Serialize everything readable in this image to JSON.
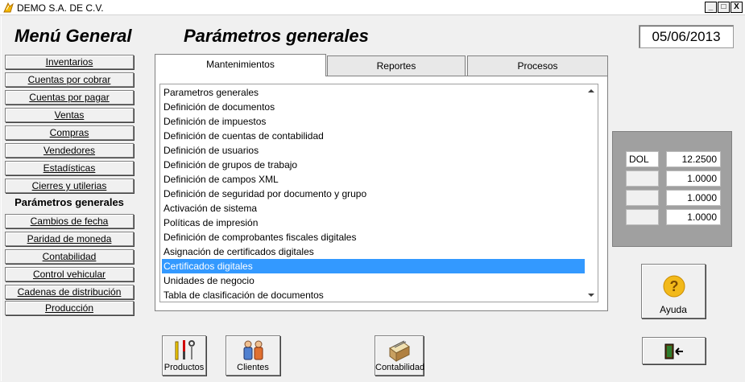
{
  "window": {
    "title": "DEMO  S.A. DE C.V.",
    "minimize": "_",
    "maximize": "□",
    "close": "X"
  },
  "headings": {
    "menu": "Menú General",
    "params": "Parámetros generales"
  },
  "date": "05/06/2013",
  "sidebar": {
    "items": [
      {
        "label": "Inventarios"
      },
      {
        "label": "Cuentas por cobrar"
      },
      {
        "label": "Cuentas por pagar"
      },
      {
        "label": "Ventas"
      },
      {
        "label": "Compras"
      },
      {
        "label": "Vendedores"
      },
      {
        "label": "Estadísticas"
      },
      {
        "label": "Cierres y utilerias"
      },
      {
        "label": "Parámetros generales",
        "active": true
      },
      {
        "label": "Cambios de fecha"
      },
      {
        "label": "Paridad de moneda"
      },
      {
        "label": "Contabilidad"
      },
      {
        "label": "Control vehicular"
      },
      {
        "label": "Cadenas de distribución"
      },
      {
        "label": "Producción"
      }
    ]
  },
  "tabs": [
    {
      "label": "Mantenimientos",
      "active": true
    },
    {
      "label": "Reportes"
    },
    {
      "label": "Procesos"
    }
  ],
  "list": {
    "items": [
      "Parametros generales",
      "Definición de documentos",
      "Definición de impuestos",
      "Definición de cuentas de contabilidad",
      "Definición de usuarios",
      "Definición de grupos de trabajo",
      "Definición de campos XML",
      "Definición de seguridad por documento y grupo",
      "Activación  de sistema",
      "Políticas de  impresión",
      "Definición de comprobantes fiscales digitales",
      "Asignación de certificados digitales",
      "Certificados digitales",
      "Unidades de negocio",
      "Tabla de clasificación de documentos"
    ],
    "selected": "Certificados digitales"
  },
  "rates": [
    {
      "currency": "DOL",
      "value": "12.2500"
    },
    {
      "currency": "",
      "value": "1.0000"
    },
    {
      "currency": "",
      "value": "1.0000"
    },
    {
      "currency": "",
      "value": "1.0000"
    }
  ],
  "buttons": {
    "help": "Ayuda",
    "products": "Productos",
    "clients": "Clientes",
    "accounting": "Contabilidad"
  },
  "colors": {
    "selection": "#3399ff",
    "help_icon": "#f2b91a"
  }
}
